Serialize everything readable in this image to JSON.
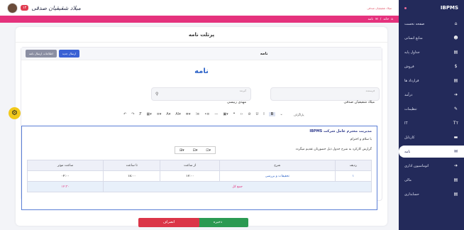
{
  "app": {
    "brand": "IBPMS"
  },
  "topbar": {
    "status_text": "میلاد شقیقیان صدقی",
    "badge_count": "۱۲",
    "user_name": "میلاد شقیقیان صدقی"
  },
  "breadcrumb": {
    "home_icon": "home-icon",
    "items": [
      "خانه",
      "نامه"
    ]
  },
  "sidebar": {
    "items": [
      {
        "label": "صفحه نخست",
        "icon": "home-icon"
      },
      {
        "label": "منابع انسانی",
        "icon": "user-icon"
      },
      {
        "label": "جداول پایه",
        "icon": "doc-icon"
      },
      {
        "label": "فروش",
        "icon": "dollar-icon"
      },
      {
        "label": "قرارداد ها",
        "icon": "doc-icon"
      },
      {
        "label": "درآمد",
        "icon": "login-icon"
      },
      {
        "label": "تنظیمات",
        "icon": "wrench-icon"
      },
      {
        "label": "IT",
        "icon": "font-icon"
      },
      {
        "label": "کارتابل",
        "icon": "folder-icon"
      },
      {
        "label": "نامه",
        "icon": "mail-icon"
      },
      {
        "label": "اتوماسیون اداری",
        "icon": "login-icon"
      },
      {
        "label": "مالی",
        "icon": "doc-icon"
      },
      {
        "label": "حسابداری",
        "icon": "doc-icon"
      }
    ],
    "active_index": 9
  },
  "page": {
    "title": "پرتلت نامه"
  },
  "panel": {
    "title": "نامه",
    "new_button": "ارسال جدید",
    "history_button": "اطلاعات ارسال نامه"
  },
  "letter": {
    "heading": "نامه"
  },
  "fields": {
    "receiver_label": "گیرنده",
    "receiver_value": "مهدی رییسی",
    "sender_label": "فرستنده",
    "sender_value": "میلاد شقیقیان صدقی"
  },
  "toolbar": {
    "paragraph_label": "پاراگراف"
  },
  "editor": {
    "line1": "مدیریت محترم عامل شرکت IBPMS",
    "line2": "با سلام و احترام",
    "line3": "گزارش کارکرد به شرح جدول ذیل حضورتان تقدیم میگردد"
  },
  "table": {
    "headers": [
      "ردیف",
      "شرح",
      "از ساعت",
      "تا ساعت",
      "ساعت موثر"
    ],
    "rows": [
      [
        "۱",
        "تحقیقات و بررسی",
        "۱۶:۰۰",
        "۱۸:۰۰",
        "۰۲:۰۰"
      ]
    ],
    "total_label": "جمع کل",
    "total_value": "۱۲:۳۰"
  },
  "actions": {
    "save": "ذخیره",
    "cancel": "انصراف"
  },
  "colors": {
    "sidebar": "#232a5a",
    "accent": "#e5327d",
    "save": "#2b9a52",
    "cancel": "#db3548",
    "link": "#2d63c8"
  }
}
